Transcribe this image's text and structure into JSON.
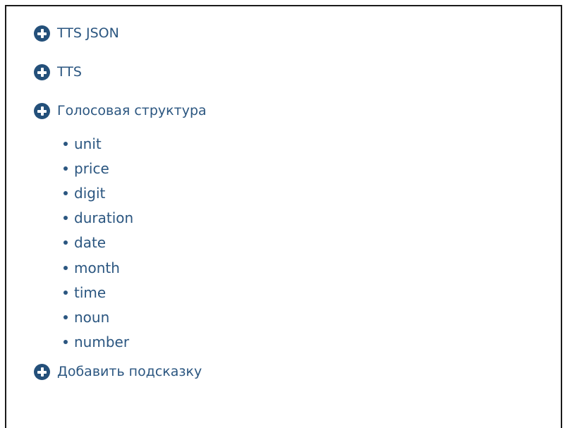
{
  "tree": {
    "items": [
      {
        "label": "TTS JSON",
        "icon": "plus-circle-icon"
      },
      {
        "label": "TTS",
        "icon": "plus-circle-icon"
      },
      {
        "label": "Голосовая структура",
        "icon": "plus-circle-icon"
      }
    ],
    "voice_structure_children": [
      {
        "label": "unit"
      },
      {
        "label": "price"
      },
      {
        "label": "digit"
      },
      {
        "label": "duration"
      },
      {
        "label": "date"
      },
      {
        "label": "month"
      },
      {
        "label": "time"
      },
      {
        "label": "noun"
      },
      {
        "label": "number"
      }
    ],
    "add_hint": {
      "label": "Добавить подсказку",
      "icon": "plus-circle-icon"
    }
  },
  "colors": {
    "link": "#2b5680",
    "icon": "#24507a",
    "border": "#1a1a1a"
  }
}
